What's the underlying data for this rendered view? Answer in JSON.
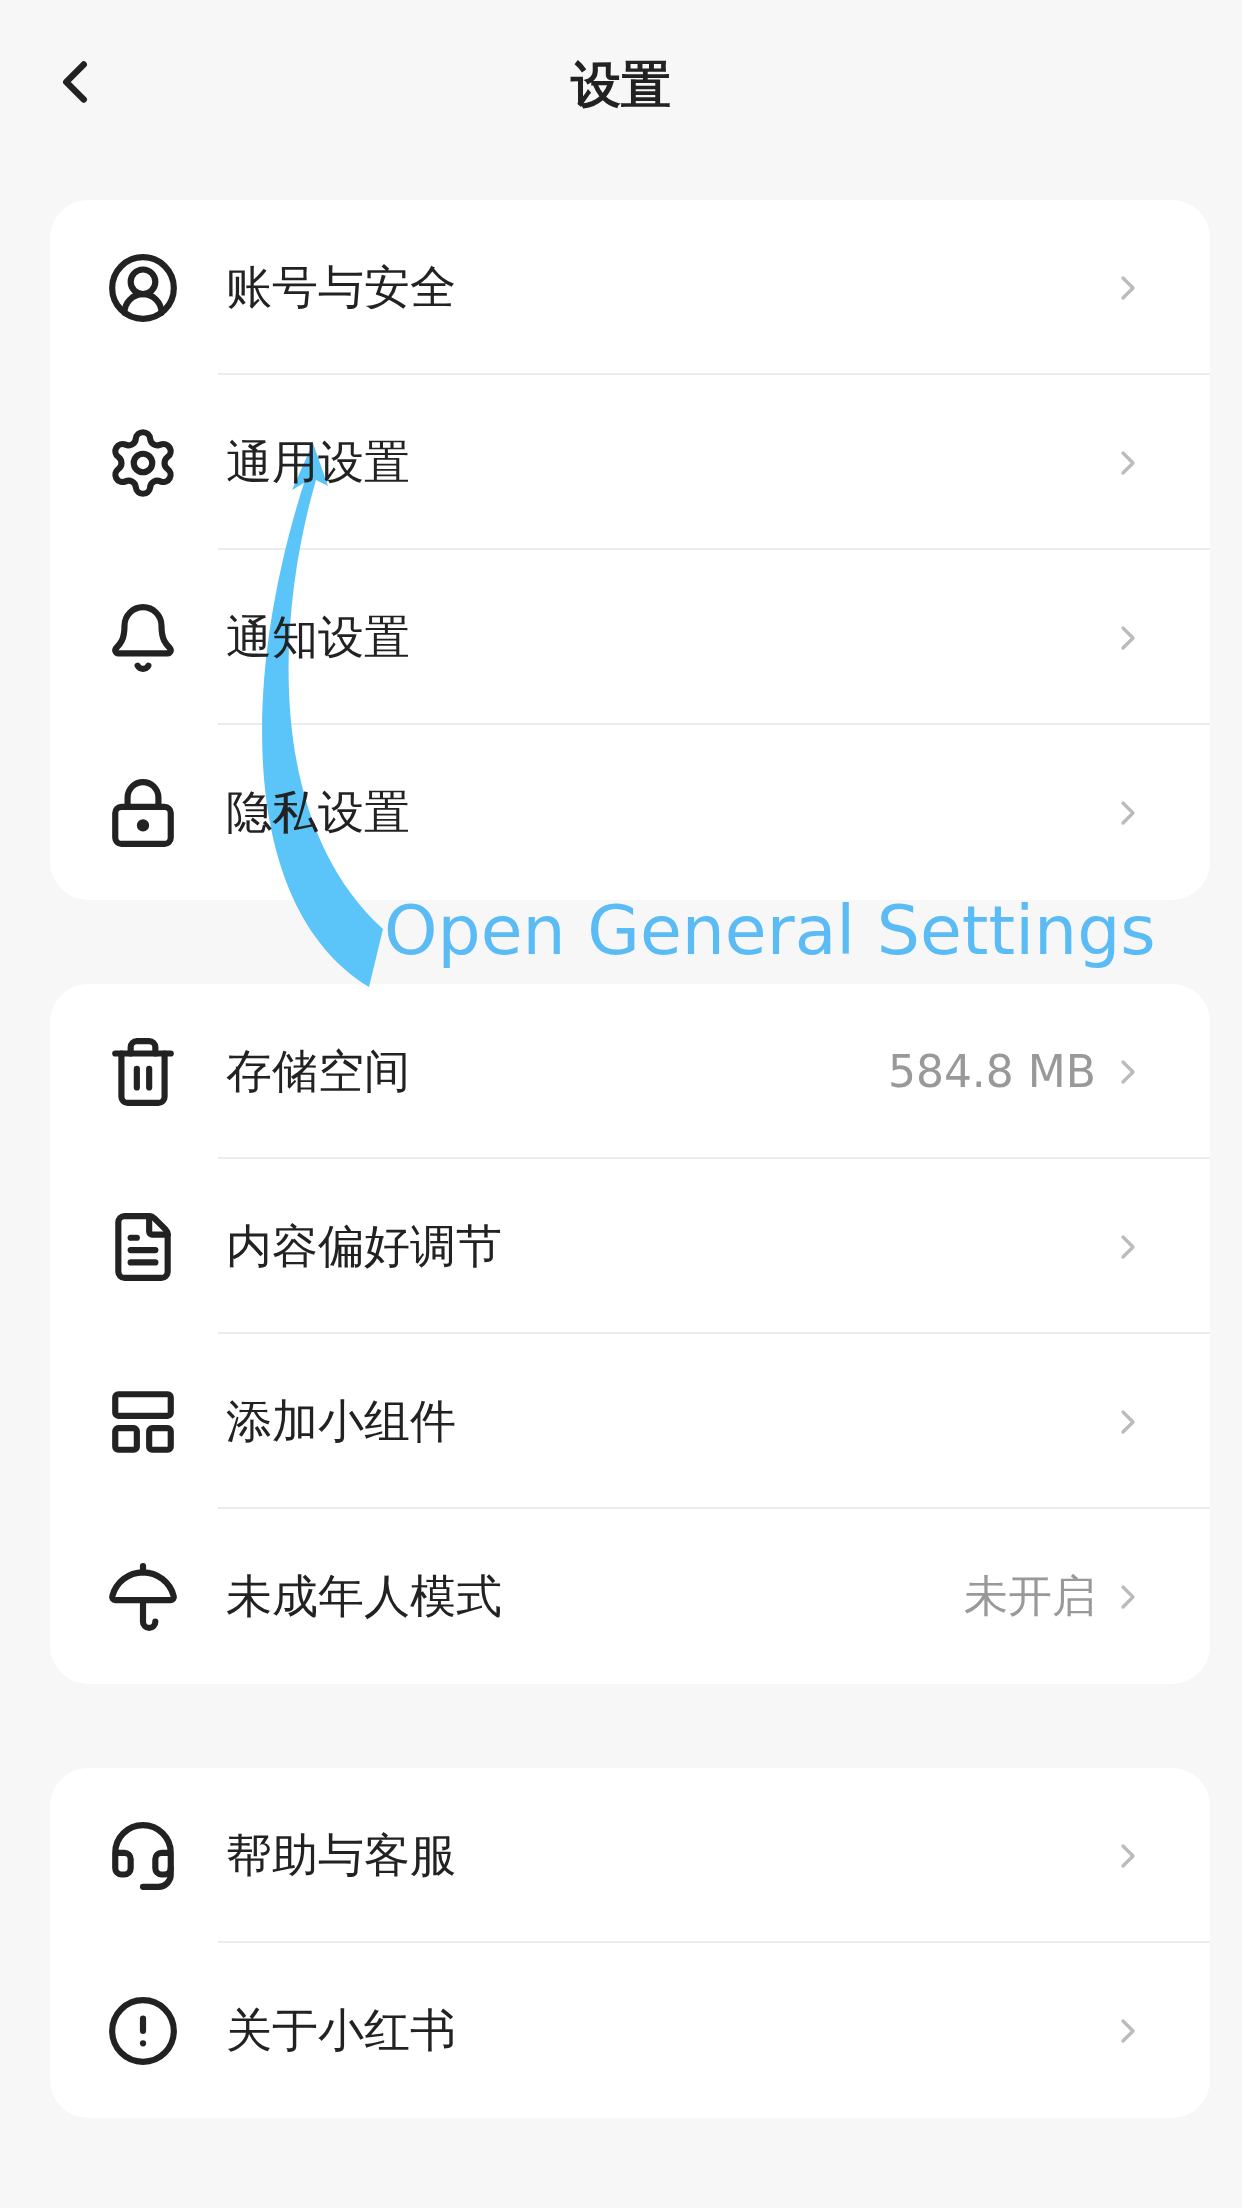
{
  "header": {
    "title": "设置"
  },
  "groups": [
    {
      "items": [
        {
          "label": "账号与安全"
        },
        {
          "label": "通用设置"
        },
        {
          "label": "通知设置"
        },
        {
          "label": "隐私设置"
        }
      ]
    },
    {
      "items": [
        {
          "label": "存储空间",
          "value": "584.8 MB"
        },
        {
          "label": "内容偏好调节"
        },
        {
          "label": "添加小组件"
        },
        {
          "label": "未成年人模式",
          "value": "未开启"
        }
      ]
    },
    {
      "items": [
        {
          "label": "帮助与客服"
        },
        {
          "label": "关于小红书"
        }
      ]
    }
  ],
  "annotation": {
    "text": "Open General Settings"
  }
}
